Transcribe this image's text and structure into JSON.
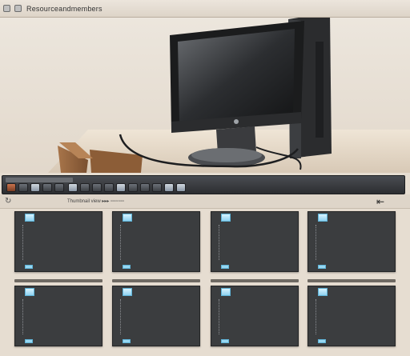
{
  "window": {
    "title": "Resourceandmembers"
  },
  "colors": {
    "background": "#e6ddd1",
    "toolbar": "#2c2e31",
    "tile": "#3b3d3f",
    "accent": "#8fd2f0"
  },
  "icons": {
    "toolbar_left": "S",
    "subbar_left": "↻",
    "subbar_right": "⇤"
  },
  "toolbar": {
    "button_count": 15
  },
  "subbar": {
    "caption": "Thumbnail view ▸▸▸ ▫▫▫▫▫▫▫▫"
  },
  "grid": {
    "tiles": [
      {
        "name": "thumbnail-1"
      },
      {
        "name": "thumbnail-2"
      },
      {
        "name": "thumbnail-3"
      },
      {
        "name": "thumbnail-4"
      },
      {
        "name": "thumbnail-5"
      },
      {
        "name": "thumbnail-6"
      },
      {
        "name": "thumbnail-7"
      },
      {
        "name": "thumbnail-8"
      }
    ]
  }
}
